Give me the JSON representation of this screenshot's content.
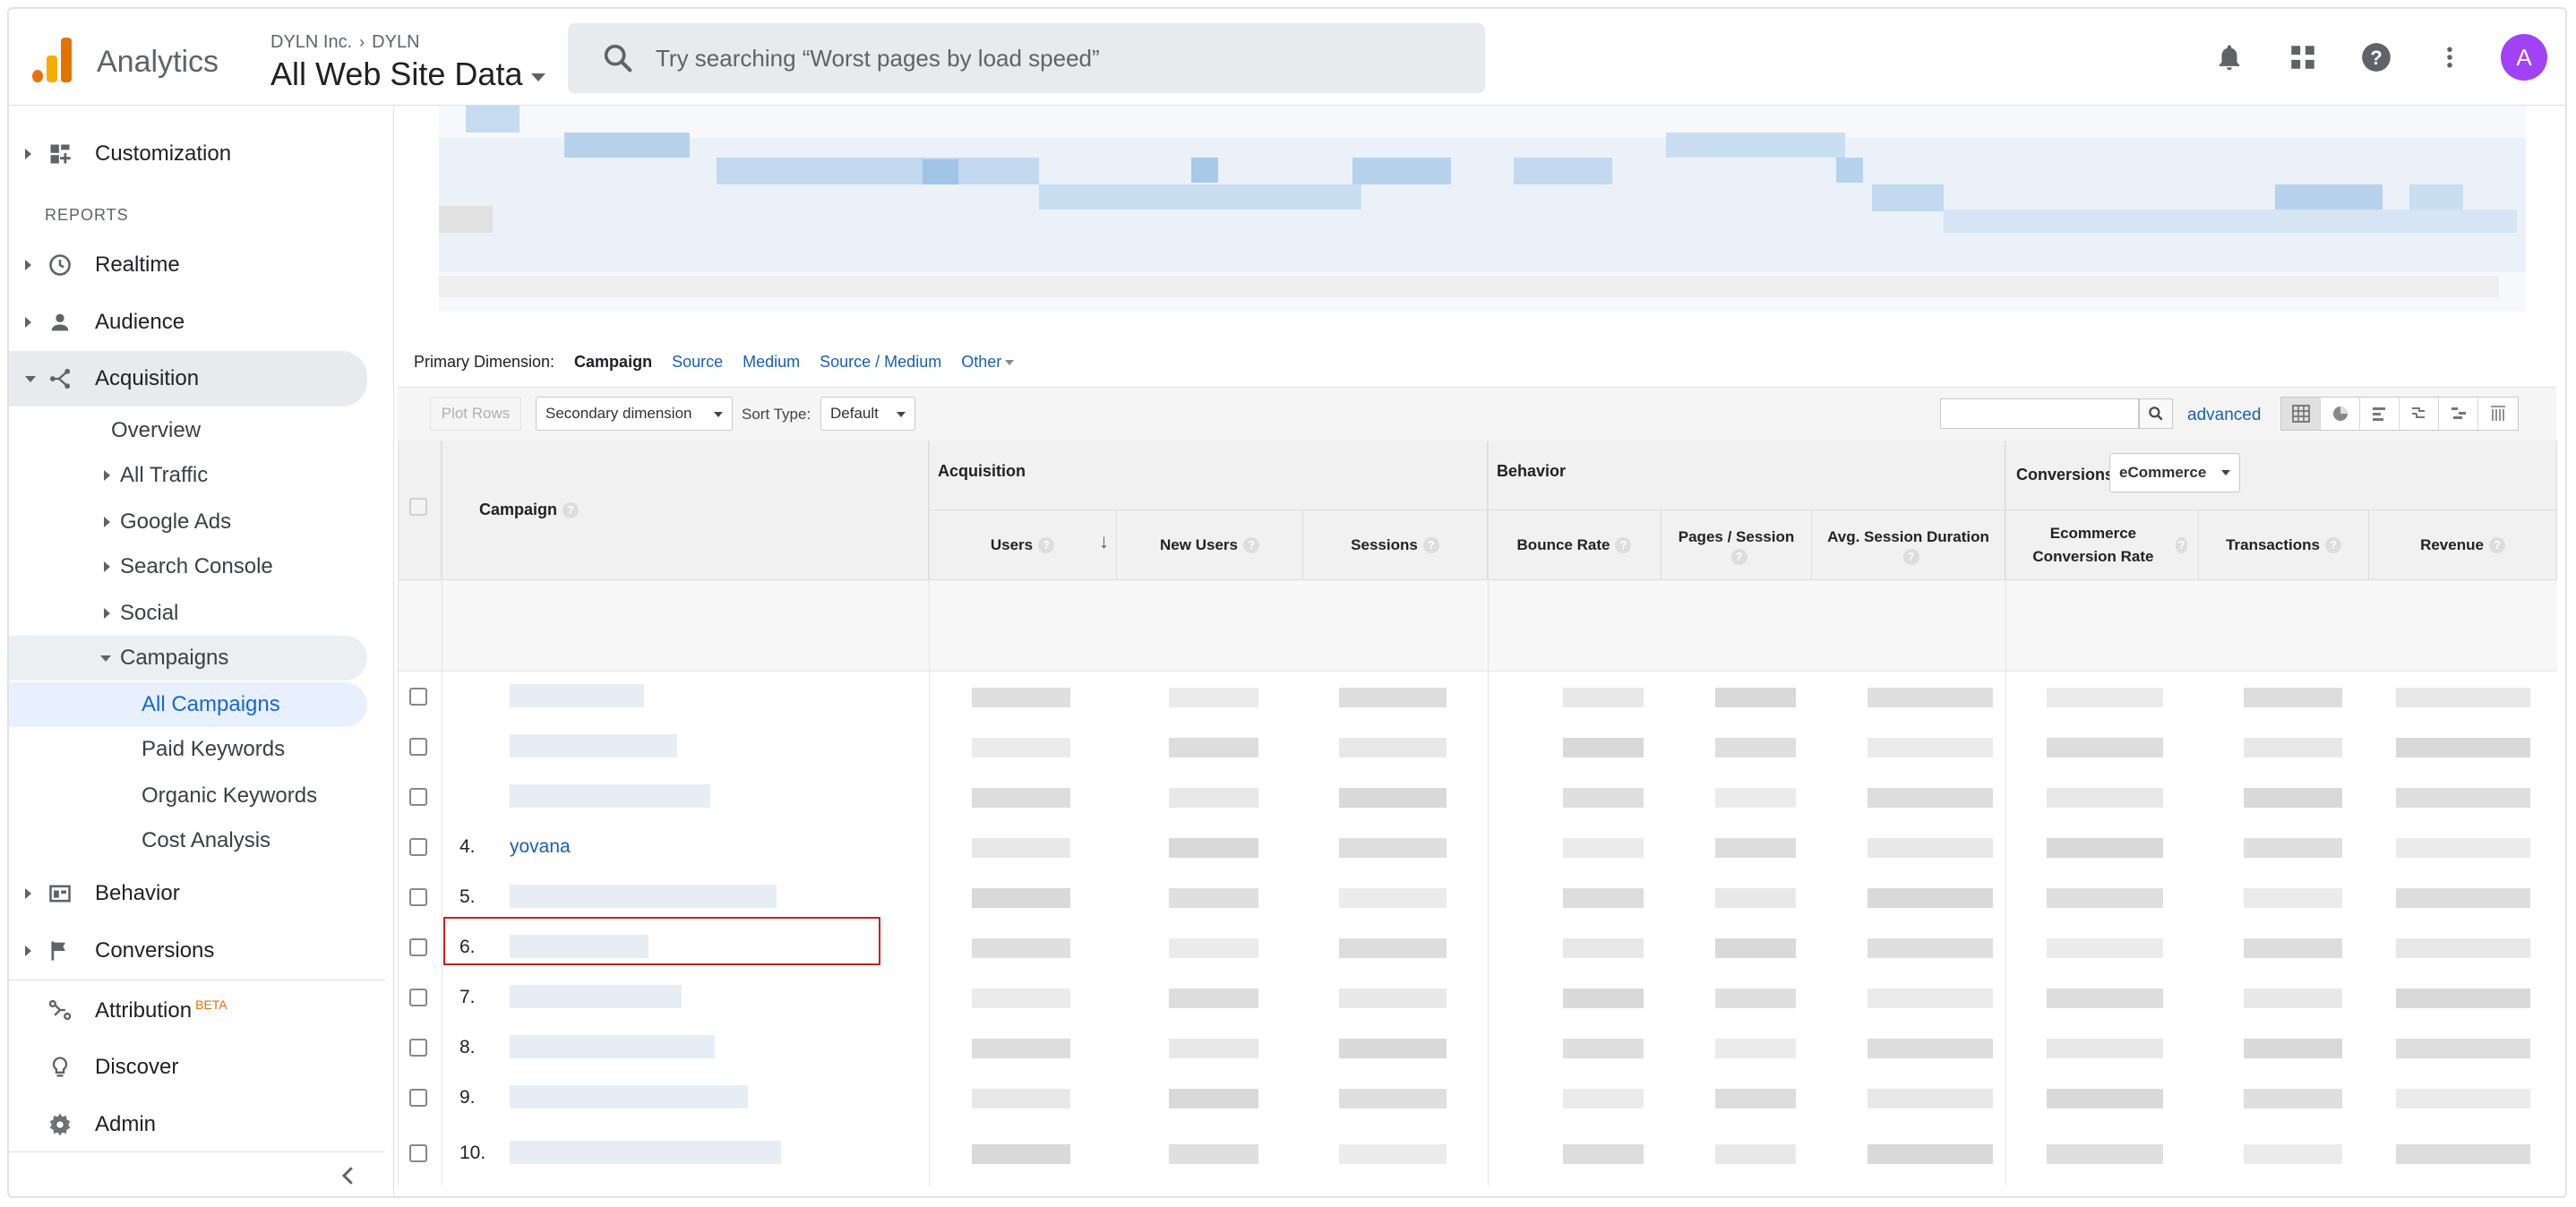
{
  "header": {
    "app_name": "Analytics",
    "account": "DYLN Inc.",
    "account_sub": "DYLN",
    "property": "All Web Site Data",
    "search_placeholder": "Try searching “Worst pages by load speed”",
    "avatar_letter": "A"
  },
  "sidebar": {
    "customization": "Customization",
    "reports_label": "REPORTS",
    "realtime": "Realtime",
    "audience": "Audience",
    "acquisition": "Acquisition",
    "overview": "Overview",
    "all_traffic": "All Traffic",
    "google_ads": "Google Ads",
    "search_console": "Search Console",
    "social": "Social",
    "campaigns": "Campaigns",
    "all_campaigns": "All Campaigns",
    "paid_keywords": "Paid Keywords",
    "organic_keywords": "Organic Keywords",
    "cost_analysis": "Cost Analysis",
    "behavior": "Behavior",
    "conversions": "Conversions",
    "attribution": "Attribution",
    "attribution_badge": "BETA",
    "discover": "Discover",
    "admin": "Admin"
  },
  "dimensions": {
    "label": "Primary Dimension:",
    "current": "Campaign",
    "source": "Source",
    "medium": "Medium",
    "source_medium": "Source / Medium",
    "other": "Other"
  },
  "toolbar": {
    "plot_rows": "Plot Rows",
    "secondary_dimension": "Secondary dimension",
    "sort_type_label": "Sort Type:",
    "sort_type_value": "Default",
    "advanced": "advanced"
  },
  "table": {
    "campaign_header": "Campaign",
    "group_acquisition": "Acquisition",
    "group_behavior": "Behavior",
    "group_conversions": "Conversions",
    "conversions_select": "eCommerce",
    "columns": {
      "users": "Users",
      "new_users": "New Users",
      "sessions": "Sessions",
      "bounce_rate": "Bounce Rate",
      "pages_session": "Pages / Session",
      "avg_session": "Avg. Session Duration",
      "ecom_rate": "Ecommerce Conversion Rate",
      "transactions": "Transactions",
      "revenue": "Revenue"
    },
    "rows": [
      {
        "num": "",
        "name": ""
      },
      {
        "num": "",
        "name": ""
      },
      {
        "num": "",
        "name": ""
      },
      {
        "num": "4.",
        "name": "yovana"
      },
      {
        "num": "5.",
        "name": ""
      },
      {
        "num": "6.",
        "name": ""
      },
      {
        "num": "7.",
        "name": ""
      },
      {
        "num": "8.",
        "name": ""
      },
      {
        "num": "9.",
        "name": ""
      },
      {
        "num": "10.",
        "name": ""
      }
    ]
  }
}
